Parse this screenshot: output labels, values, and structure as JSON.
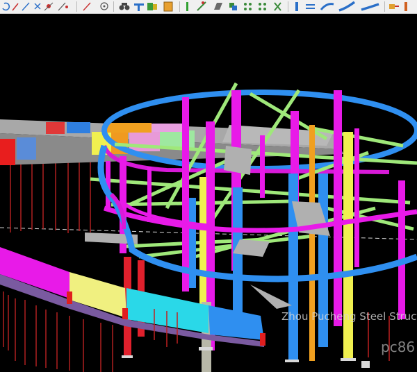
{
  "toolbar": {
    "tools": [
      {
        "icon": "rotate-icon"
      },
      {
        "icon": "pencil-icon"
      },
      {
        "icon": "line-icon"
      },
      {
        "icon": "cross-icon"
      },
      {
        "icon": "node-icon"
      },
      {
        "icon": "measure-icon"
      },
      {
        "icon": "target-icon"
      },
      {
        "icon": "binoculars-icon"
      },
      {
        "icon": "beam-tool-icon"
      },
      {
        "icon": "paint-icon"
      },
      {
        "icon": "box-icon"
      },
      {
        "icon": "column-tool-icon"
      },
      {
        "icon": "brace-tool-icon"
      },
      {
        "icon": "plate-icon"
      },
      {
        "icon": "copy-part-icon"
      },
      {
        "icon": "bolt-group-icon"
      },
      {
        "icon": "weld-group-icon"
      },
      {
        "icon": "cut-icon"
      },
      {
        "icon": "column-icon"
      },
      {
        "icon": "beam-icon"
      },
      {
        "icon": "curved-beam-icon"
      },
      {
        "icon": "pipe-icon"
      },
      {
        "icon": "poly-beam-icon"
      },
      {
        "icon": "pick-icon"
      }
    ]
  },
  "watermark": {
    "text": "Zhou Pucheng Steel Structu",
    "site": "pc86"
  },
  "colors": {
    "background": "#000000",
    "ring_beam": "#2f8ff0",
    "columns": "#e81ae8",
    "braces": "#9fe87a",
    "orange_column": "#f0a020",
    "red_column": "#e0202c",
    "yellow_column": "#f0f050"
  }
}
